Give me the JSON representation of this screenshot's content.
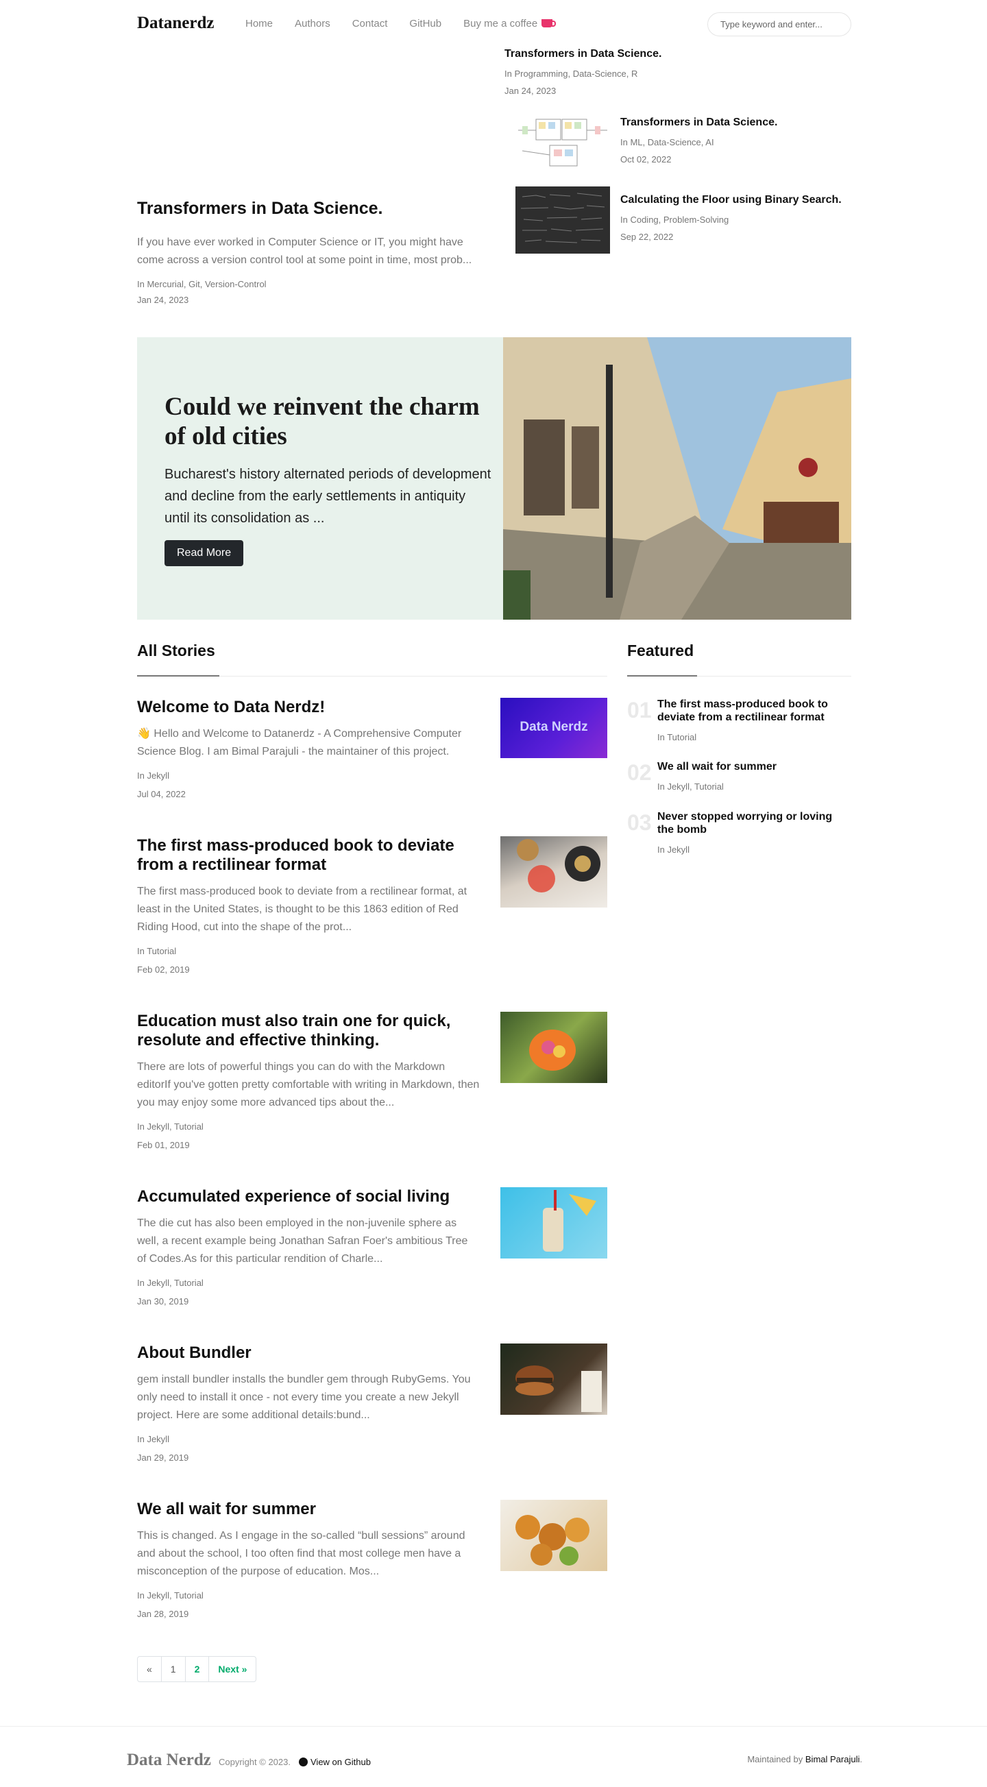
{
  "navbar": {
    "brand": "Datanerdz",
    "links": [
      "Home",
      "Authors",
      "Contact",
      "GitHub",
      "Buy me a coffee"
    ],
    "search_placeholder": "Type keyword and enter..."
  },
  "top": {
    "main": {
      "title": "Transformers in Data Science.",
      "excerpt": "If you have ever worked in Computer Science or IT, you might have come across a version control tool at some point in time, most prob...",
      "categories": "In Mercurial, Git, Version-Control",
      "date": "Jan 24, 2023"
    },
    "side": [
      {
        "title": "Transformers in Data Science.",
        "categories": "In Programming, Data-Science, R",
        "date": "Jan 24, 2023"
      },
      {
        "title": "Transformers in Data Science.",
        "categories": "In ML, Data-Science, AI",
        "date": "Oct 02, 2022"
      },
      {
        "title": "Calculating the Floor using Binary Search.",
        "categories": "In Coding, Problem-Solving",
        "date": "Sep 22, 2022"
      }
    ]
  },
  "jumbotron": {
    "title": "Could we reinvent the charm of old cities",
    "lead": "Bucharest's history alternated periods of development and decline from the early settlements in antiquity until its consolidation as ...",
    "button": "Read More"
  },
  "all_stories": {
    "heading": "All Stories",
    "items": [
      {
        "title": "Welcome to Data Nerdz!",
        "excerpt": "👋 Hello and Welcome to Datanerdz - A Comprehensive Computer Science Blog. I am Bimal Parajuli - the maintainer of this project.",
        "categories": "In Jekyll",
        "date": "Jul 04, 2022",
        "thumb_text": "Data Nerdz"
      },
      {
        "title": "The first mass-produced book to deviate from a rectilinear format",
        "excerpt": "The first mass-produced book to deviate from a rectilinear format, at least in the United States, is thought to be this 1863 edition of Red Riding Hood, cut into the shape of the prot...",
        "categories": "In Tutorial",
        "date": "Feb 02, 2019"
      },
      {
        "title": "Education must also train one for quick, resolute and effective thinking.",
        "excerpt": "There are lots of powerful things you can do with the Markdown editorIf you've gotten pretty comfortable with writing in Markdown, then you may enjoy some more advanced tips about the...",
        "categories": "In Jekyll, Tutorial",
        "date": "Feb 01, 2019"
      },
      {
        "title": "Accumulated experience of social living",
        "excerpt": "The die cut has also been employed in the non-juvenile sphere as well, a recent example being Jonathan Safran Foer's ambitious Tree of Codes.As for this particular rendition of Charle...",
        "categories": "In Jekyll, Tutorial",
        "date": "Jan 30, 2019"
      },
      {
        "title": "About Bundler",
        "excerpt": "gem install bundler installs the bundler gem through RubyGems. You only need to install it once - not every time you create a new Jekyll project. Here are some additional details:bund...",
        "categories": "In Jekyll",
        "date": "Jan 29, 2019"
      },
      {
        "title": "We all wait for summer",
        "excerpt": "This is changed. As I engage in the so-called “bull sessions” around and about the school, I too often find that most college men have a misconception of the purpose of education. Mos...",
        "categories": "In Jekyll, Tutorial",
        "date": "Jan 28, 2019"
      }
    ]
  },
  "featured": {
    "heading": "Featured",
    "items": [
      {
        "num": "01",
        "title": "The first mass-produced book to deviate from a rectilinear format",
        "categories": "In Tutorial"
      },
      {
        "num": "02",
        "title": "We all wait for summer",
        "categories": "In Jekyll, Tutorial"
      },
      {
        "num": "03",
        "title": "Never stopped worrying or loving the bomb",
        "categories": "In Jekyll"
      }
    ]
  },
  "pagination": {
    "prev": "«",
    "pages": [
      "1",
      "2"
    ],
    "next": "Next »"
  },
  "footer": {
    "brand": "Data Nerdz",
    "copyright": "Copyright © 2023.",
    "github": "View on Github",
    "maintained_prefix": "Maintained by",
    "maintainer": "Bimal Parajuli",
    "suffix": "."
  },
  "colors": {
    "accent": "#00ab6b",
    "jumbotron_bg": "#e8f2ec",
    "button_dark": "#23272b",
    "coffee": "#e8336b"
  }
}
